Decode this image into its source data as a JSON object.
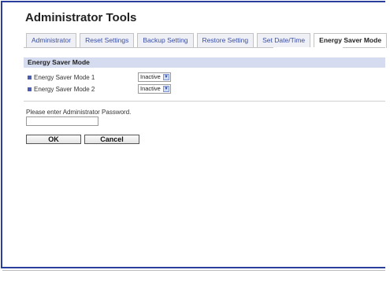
{
  "title": "Administrator Tools",
  "tabs": [
    {
      "label": "Administrator",
      "active": false
    },
    {
      "label": "Reset Settings",
      "active": false
    },
    {
      "label": "Backup Setting",
      "active": false
    },
    {
      "label": "Restore Setting",
      "active": false
    },
    {
      "label": "Set Date/Time",
      "active": false
    },
    {
      "label": "Energy Saver Mode",
      "active": true
    }
  ],
  "section": {
    "header": "Energy Saver Mode",
    "rows": [
      {
        "label": "Energy Saver Mode 1",
        "value": "Inactive"
      },
      {
        "label": "Energy Saver Mode 2",
        "value": "Inactive"
      }
    ]
  },
  "password": {
    "label": "Please enter Administrator Password.",
    "value": ""
  },
  "buttons": {
    "ok": "OK",
    "cancel": "Cancel"
  },
  "colors": {
    "frame_border": "#2a3f9c",
    "section_header_bg": "#d6dcf0",
    "tab_text": "#3a4ea6"
  }
}
